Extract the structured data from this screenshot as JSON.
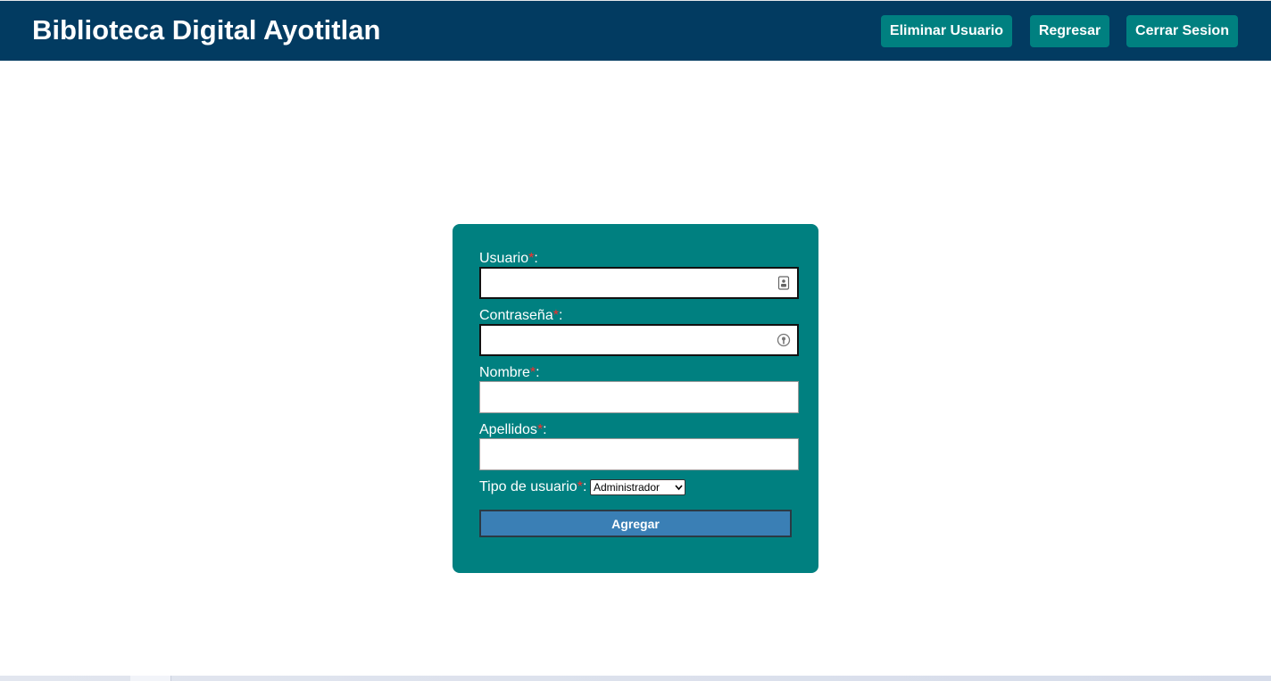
{
  "header": {
    "title": "Biblioteca Digital Ayotitlan",
    "buttons": {
      "eliminar": "Eliminar Usuario",
      "regresar": "Regresar",
      "cerrar": "Cerrar Sesion"
    }
  },
  "form": {
    "required_mark": "*",
    "usuario": {
      "label": "Usuario",
      "value": "",
      "icon": "contact-card-icon"
    },
    "contrasena": {
      "label": "Contraseña",
      "value": "",
      "icon": "password-key-icon"
    },
    "nombre": {
      "label": "Nombre",
      "value": ""
    },
    "apellidos": {
      "label": "Apellidos",
      "value": ""
    },
    "tipo": {
      "label": "Tipo de usuario",
      "selected": "Administrador"
    },
    "submit_label": "Agregar"
  },
  "colors": {
    "header_bg": "#023b61",
    "accent": "#008080",
    "submit_bg": "#3a7fb5",
    "required": "#ff2a2a"
  }
}
